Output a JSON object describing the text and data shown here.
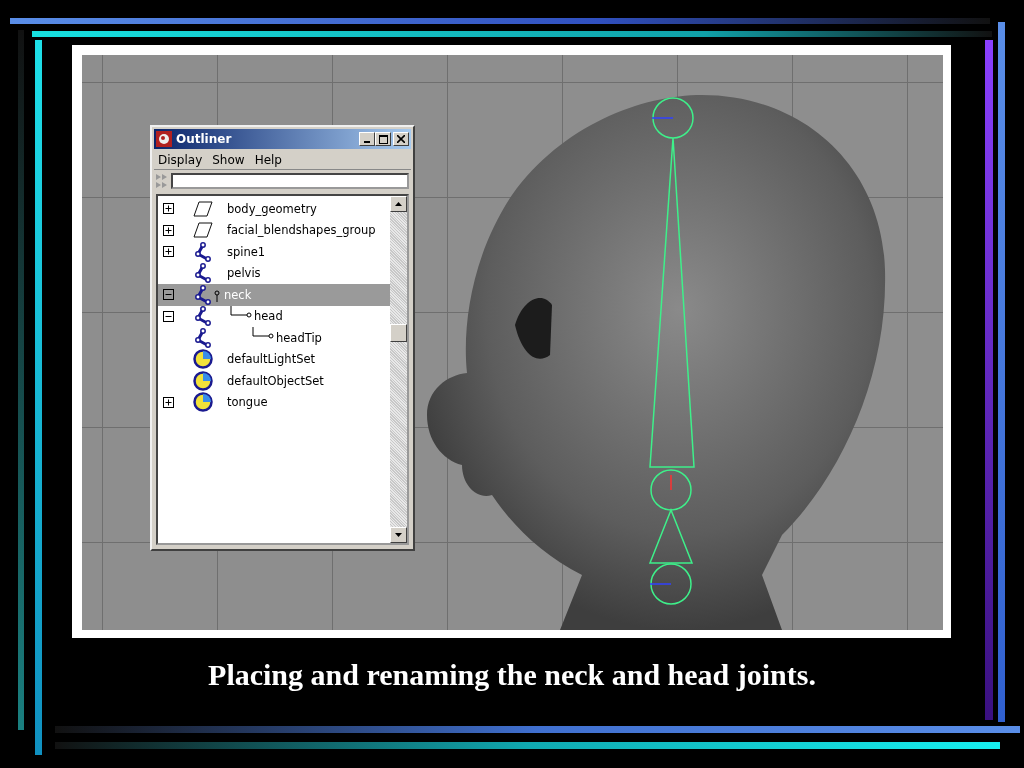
{
  "outliner": {
    "title": "Outliner",
    "menu": [
      "Display",
      "Show",
      "Help"
    ],
    "items": [
      {
        "name": "body_geometry",
        "kind": "geometry",
        "expanded": false,
        "selected": false
      },
      {
        "name": "facial_blendshapes_group",
        "kind": "geometry",
        "expanded": false,
        "selected": false
      },
      {
        "name": "spine1",
        "kind": "joint",
        "expanded": false,
        "selected": false
      },
      {
        "name": "pelvis",
        "kind": "joint",
        "selected": false
      },
      {
        "name": "neck",
        "kind": "joint",
        "expanded": true,
        "selected": true,
        "children": [
          {
            "name": "head",
            "kind": "joint",
            "expanded": true,
            "selected": false,
            "children": [
              {
                "name": "headTip",
                "kind": "joint",
                "selected": false
              }
            ]
          }
        ]
      },
      {
        "name": "defaultLightSet",
        "kind": "set",
        "selected": false
      },
      {
        "name": "defaultObjectSet",
        "kind": "set",
        "selected": false
      },
      {
        "name": "tongue",
        "kind": "set",
        "expanded": false,
        "selected": false
      }
    ]
  },
  "caption": "Placing and renaming the neck and head joints."
}
